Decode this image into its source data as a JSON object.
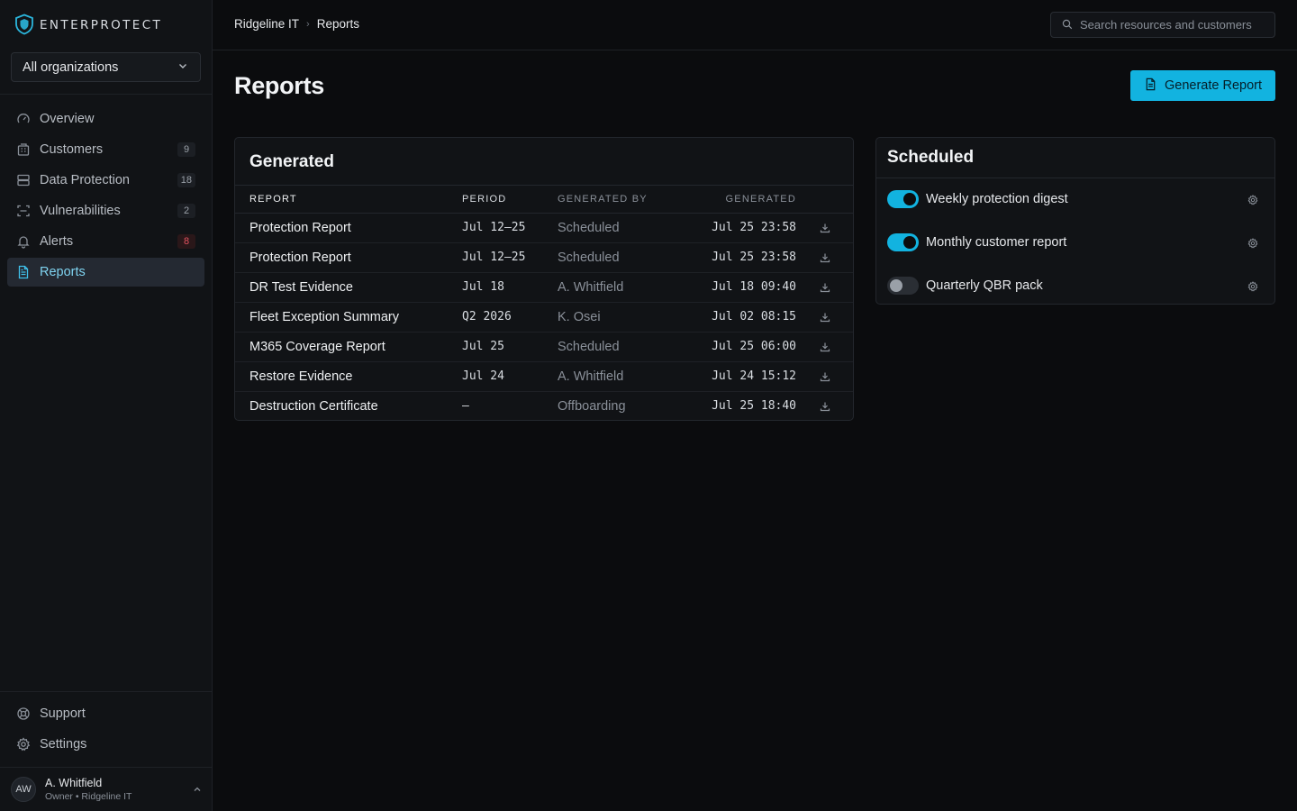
{
  "brand": {
    "name": "ENTERPROTECT"
  },
  "org_selector": {
    "value": "All organizations"
  },
  "sidebar": {
    "items": [
      {
        "label": "Overview",
        "icon": "gauge-icon",
        "count": ""
      },
      {
        "label": "Customers",
        "icon": "building-icon",
        "count": "9"
      },
      {
        "label": "Data Protection",
        "icon": "database-icon",
        "count": "18"
      },
      {
        "label": "Vulnerabilities",
        "icon": "scan-icon",
        "count": "2"
      },
      {
        "label": "Alerts",
        "icon": "bell-icon",
        "count": "8"
      },
      {
        "label": "Reports",
        "icon": "file-text-icon",
        "count": "",
        "active": true
      }
    ],
    "bottom": [
      {
        "label": "Support",
        "icon": "lifebuoy-icon"
      },
      {
        "label": "Settings",
        "icon": "gear-icon"
      }
    ]
  },
  "user": {
    "initials": "AW",
    "name": "A. Whitfield",
    "role": "Owner • Ridgeline IT"
  },
  "breadcrumb": {
    "parent": "Ridgeline IT",
    "current": "Reports"
  },
  "search": {
    "placeholder": "Search resources and customers"
  },
  "page": {
    "title": "Reports",
    "generate_label": "Generate Report"
  },
  "generated": {
    "title": "Generated",
    "columns": {
      "report": "REPORT",
      "period": "PERIOD",
      "generated_by": "GENERATED BY",
      "generated": "GENERATED"
    },
    "rows": [
      {
        "report": "Protection Report",
        "period": "Jul 12–25",
        "by": "Scheduled",
        "generated": "Jul 25 23:58"
      },
      {
        "report": "Protection Report",
        "period": "Jul 12–25",
        "by": "Scheduled",
        "generated": "Jul 25 23:58"
      },
      {
        "report": "DR Test Evidence",
        "period": "Jul 18",
        "by": "A. Whitfield",
        "generated": "Jul 18 09:40"
      },
      {
        "report": "Fleet Exception Summary",
        "period": "Q2 2026",
        "by": "K. Osei",
        "generated": "Jul 02 08:15"
      },
      {
        "report": "M365 Coverage Report",
        "period": "Jul 25",
        "by": "Scheduled",
        "generated": "Jul 25 06:00"
      },
      {
        "report": "Restore Evidence",
        "period": "Jul 24",
        "by": "A. Whitfield",
        "generated": "Jul 24 15:12"
      },
      {
        "report": "Destruction Certificate",
        "period": "–",
        "by": "Offboarding",
        "generated": "Jul 25 18:40"
      }
    ]
  },
  "scheduled": {
    "title": "Scheduled",
    "items": [
      {
        "label": "Weekly protection digest",
        "enabled": true
      },
      {
        "label": "Monthly customer report",
        "enabled": true
      },
      {
        "label": "Quarterly QBR pack",
        "enabled": false
      }
    ]
  },
  "colors": {
    "accent": "#12b3e0",
    "alert": "#e0525f",
    "background": "#0b0c0e",
    "sidebar": "#111316"
  }
}
